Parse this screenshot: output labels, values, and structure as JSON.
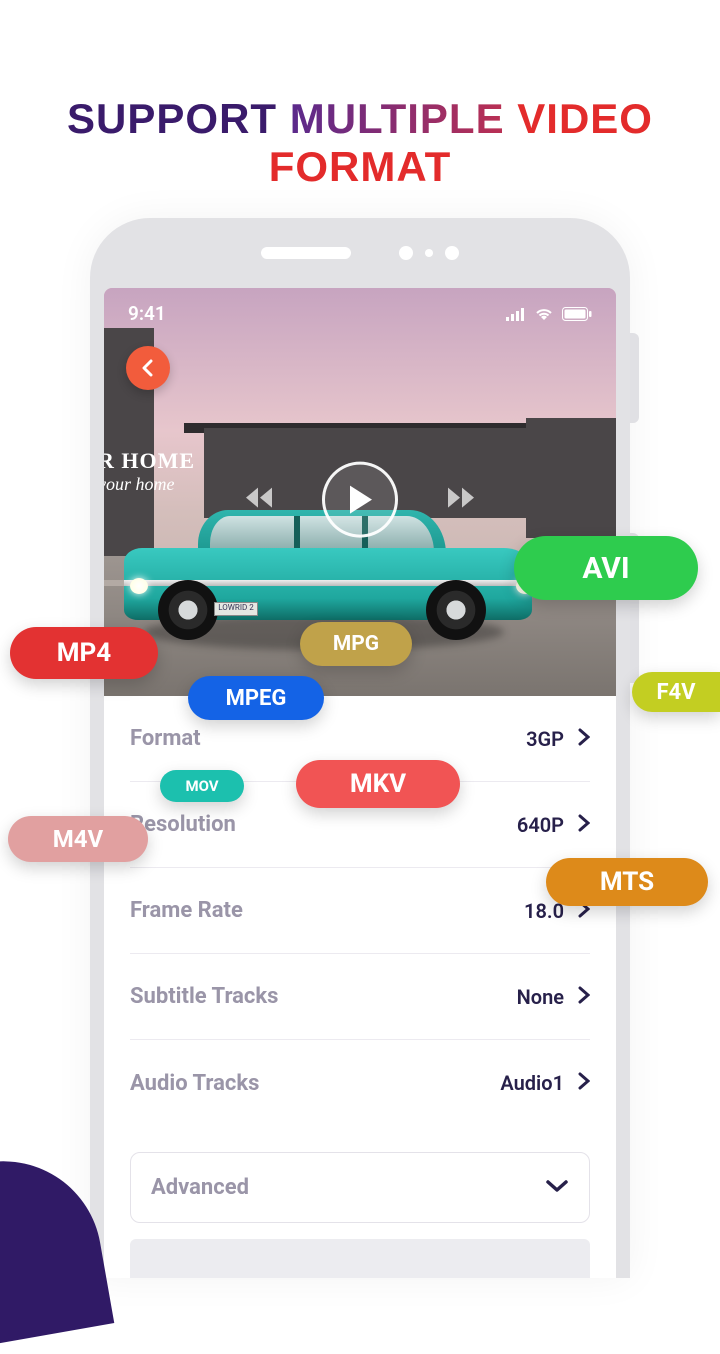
{
  "headline": {
    "part1": "SUPPORT ",
    "part2": "MULTIPLE ",
    "part3": "VIDEO FORMAT"
  },
  "status": {
    "time": "9:41"
  },
  "sign": {
    "line1": "R HOME",
    "line2": "your home"
  },
  "plate": "LOWRID 2",
  "settings": {
    "format": {
      "label": "Format",
      "value": "3GP"
    },
    "resolution": {
      "label": "Resolution",
      "value": "640P"
    },
    "framerate": {
      "label": "Frame Rate",
      "value": "18.0"
    },
    "subtitle": {
      "label": "Subtitle Tracks",
      "value": "None"
    },
    "audio": {
      "label": "Audio Tracks",
      "value": "Audio1"
    }
  },
  "advanced": {
    "label": "Advanced"
  },
  "pills": {
    "mp4": "MP4",
    "mpg": "MPG",
    "avi": "AVI",
    "mpeg": "MPEG",
    "f4v": "F4V",
    "mov": "MOV",
    "mkv": "MKV",
    "m4v": "M4V",
    "mts": "MTS"
  }
}
